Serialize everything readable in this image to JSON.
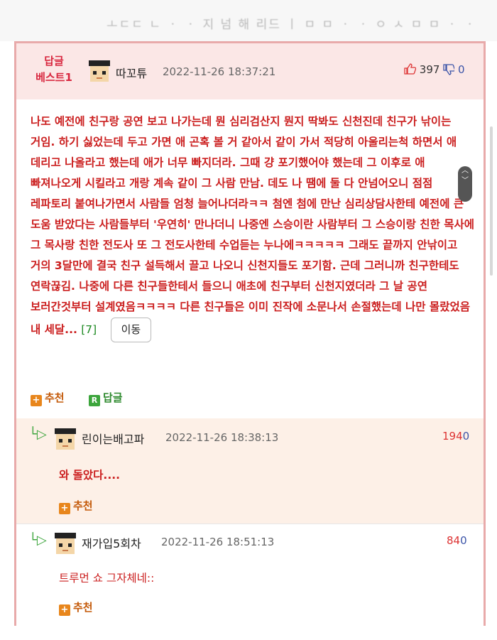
{
  "top": {
    "faded_text": "ㅗㄷㄷ ㄴ ㆍ ㆍ 지 넘 해 리드 ㅣ ㅁ ㅁ ㆍ ㆍ ㅇ ㅅ ㅁ ㅁ ㆍ ㆍ"
  },
  "best_comment": {
    "badge_line1": "답글",
    "badge_line2": "베스트1",
    "author": "따꼬튜",
    "date": "2022-11-26 18:37:21",
    "likes": "397",
    "dislikes": "0",
    "text": "나도 예전에 친구랑 공연 보고 나가는데 뭔 심리검산지 뭔지 딱봐도 신천진데 친구가 낚이는 거임. 하기 싫었는데 두고 가면 애 곤혹 볼 거 같아서 같이 가서 적당히 아울리는척 하면서 애 데리고 나올라고 했는데 애가 너무 빠지더라. 그때 걍 포기했어야 했는데 그 이후로 애 빠져나오게 시킬라고 개랑 계속 같이 그 사람 만남. 데도 나 땜에 둘 다 안넘어오니 점점 레파토리 붙여나가면서 사람들 엄청 늘어나더라ㅋㅋ 첨엔 첨에 만난 심리상담사한테 예전에 큰 도움 받았다는 사람들부터 '우연히' 만나더니 나중엔 스승이란 사람부터 그 스승이랑 친한 목사에 그 목사랑 친한 전도사 또 그 전도사한테 수업듣는 누나에ㅋㅋㅋㅋㅋ 그래도 끝까지 안낚이고 거의 3달만에 결국 친구 설득해서 끌고 나오니 신천지들도 포기함. 근데 그러니까 친구한테도 연락끊김. 나중에 다른 친구들한테서 들으니 애초에 친구부터 신천지였더라 그 날 공연 보러간것부터 설계였음ㅋㅋㅋㅋ 다른 친구들은 이미 진작에 소문나서 손절했는데 나만 몰랐었음 내 세달...",
    "reply_count": "[7]",
    "move_label": "이동",
    "recommend_label": "추천",
    "reply_label": "답글"
  },
  "replies": [
    {
      "author": "린이는배고파",
      "date": "2022-11-26 18:38:13",
      "likes": "194",
      "dislikes": "0",
      "text": "와 돌았다....",
      "recommend_label": "추천"
    },
    {
      "author": "재가입5회차",
      "date": "2022-11-26 18:51:13",
      "likes": "84",
      "dislikes": "0",
      "text": "트루먼 쇼 그자체네::",
      "recommend_label": "추천"
    }
  ],
  "colors": {
    "accent_red": "#cb1f1f",
    "best_bg": "#fbe7e6",
    "reply_bg": "#fdf0e7",
    "border": "#e8aaaa"
  }
}
